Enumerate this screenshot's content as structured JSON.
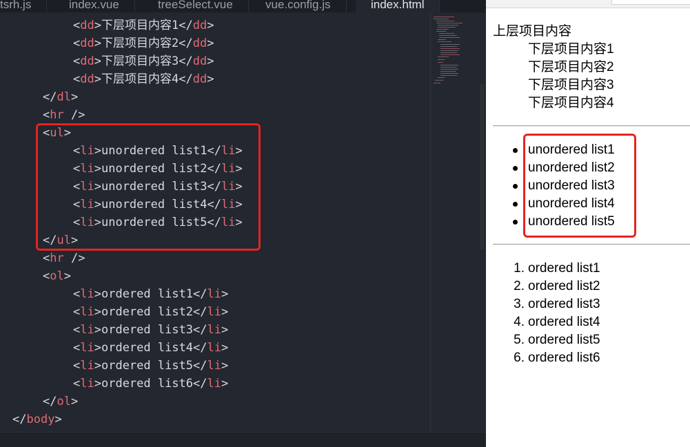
{
  "editor": {
    "tabs": [
      {
        "label": "tsrh.js",
        "active": false
      },
      {
        "label": "index.vue",
        "active": false
      },
      {
        "label": "treeSelect.vue",
        "active": false
      },
      {
        "label": "vue.config.js",
        "active": false
      },
      {
        "label": "index.html",
        "active": true
      }
    ],
    "code_lines": [
      {
        "indent": 2,
        "open": "<dd>",
        "text": "下层项目内容1",
        "close": "</dd>"
      },
      {
        "indent": 2,
        "open": "<dd>",
        "text": "下层项目内容2",
        "close": "</dd>"
      },
      {
        "indent": 2,
        "open": "<dd>",
        "text": "下层项目内容3",
        "close": "</dd>"
      },
      {
        "indent": 2,
        "open": "<dd>",
        "text": "下层项目内容4",
        "close": "</dd>"
      },
      {
        "indent": 1,
        "open": "</dl>",
        "text": "",
        "close": ""
      },
      {
        "indent": 1,
        "open": "<hr />",
        "text": "",
        "close": ""
      },
      {
        "indent": 1,
        "open": "<ul>",
        "text": "",
        "close": ""
      },
      {
        "indent": 2,
        "open": "<li>",
        "text": "unordered list1",
        "close": "</li>"
      },
      {
        "indent": 2,
        "open": "<li>",
        "text": "unordered list2",
        "close": "</li>"
      },
      {
        "indent": 2,
        "open": "<li>",
        "text": "unordered list3",
        "close": "</li>"
      },
      {
        "indent": 2,
        "open": "<li>",
        "text": "unordered list4",
        "close": "</li>"
      },
      {
        "indent": 2,
        "open": "<li>",
        "text": "unordered list5",
        "close": "</li>"
      },
      {
        "indent": 1,
        "open": "</ul>",
        "text": "",
        "close": ""
      },
      {
        "indent": 1,
        "open": "<hr />",
        "text": "",
        "close": ""
      },
      {
        "indent": 1,
        "open": "<ol>",
        "text": "",
        "close": ""
      },
      {
        "indent": 2,
        "open": "<li>",
        "text": "ordered list1",
        "close": "</li>"
      },
      {
        "indent": 2,
        "open": "<li>",
        "text": "ordered list2",
        "close": "</li>"
      },
      {
        "indent": 2,
        "open": "<li>",
        "text": "ordered list3",
        "close": "</li>"
      },
      {
        "indent": 2,
        "open": "<li>",
        "text": "ordered list4",
        "close": "</li>"
      },
      {
        "indent": 2,
        "open": "<li>",
        "text": "ordered list5",
        "close": "</li>"
      },
      {
        "indent": 2,
        "open": "<li>",
        "text": "ordered list6",
        "close": "</li>"
      },
      {
        "indent": 1,
        "open": "</ol>",
        "text": "",
        "close": ""
      },
      {
        "indent": 0,
        "open": "</body>",
        "text": "",
        "close": ""
      }
    ]
  },
  "preview": {
    "dl_term": "上层项目内容",
    "dl_items": [
      "下层项目内容1",
      "下层项目内容2",
      "下层项目内容3",
      "下层项目内容4"
    ],
    "ul_items": [
      "unordered list1",
      "unordered list2",
      "unordered list3",
      "unordered list4",
      "unordered list5"
    ],
    "ol_items": [
      "ordered list1",
      "ordered list2",
      "ordered list3",
      "ordered list4",
      "ordered list5",
      "ordered list6"
    ]
  },
  "colors": {
    "editor_bg": "#23272f",
    "tag": "#e06c75",
    "text": "#d7dae0",
    "highlight": "#e8231f"
  }
}
